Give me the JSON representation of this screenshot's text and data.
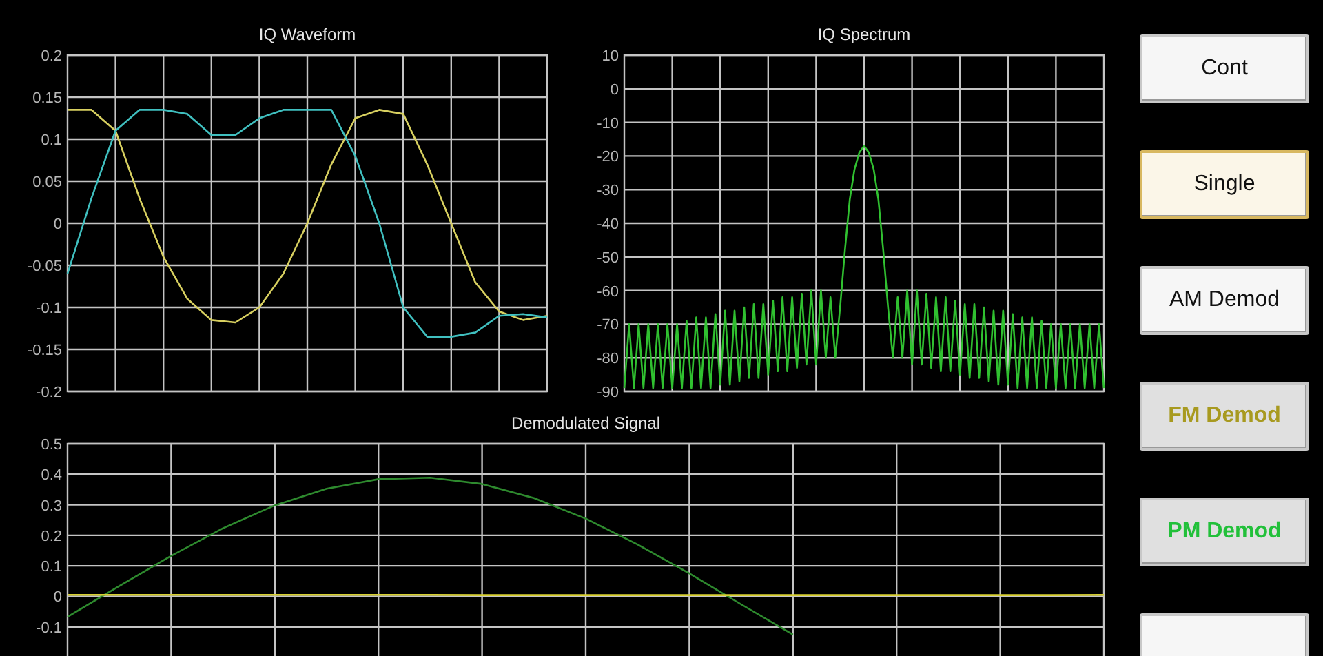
{
  "charts": [
    {
      "chart_data": {
        "type": "line",
        "title": "IQ Waveform",
        "grid": true,
        "ylim": [
          -0.2,
          0.2
        ],
        "yticks": [
          0.2,
          0.15,
          0.1,
          0.05,
          0,
          -0.05,
          -0.1,
          -0.15,
          -0.2
        ],
        "series": [
          {
            "color": "#d8d060",
            "values": [
              0.135,
              0.135,
              0.11,
              0.03,
              -0.04,
              -0.09,
              -0.115,
              -0.118,
              -0.1,
              -0.06,
              0.0,
              0.07,
              0.125,
              0.135,
              0.13,
              0.07,
              0.0,
              -0.07,
              -0.105,
              -0.115,
              -0.11
            ]
          },
          {
            "color": "#40c0c0",
            "values": [
              -0.06,
              0.03,
              0.11,
              0.135,
              0.135,
              0.13,
              0.105,
              0.105,
              0.125,
              0.135,
              0.135,
              0.135,
              0.08,
              0.0,
              -0.1,
              -0.135,
              -0.135,
              -0.13,
              -0.11,
              -0.108,
              -0.112
            ]
          }
        ]
      }
    },
    {
      "chart_data": {
        "type": "line",
        "title": "IQ Spectrum",
        "grid": true,
        "ylim": [
          -90,
          10
        ],
        "yticks": [
          10,
          0,
          -10,
          -20,
          -30,
          -40,
          -50,
          -60,
          -70,
          -80,
          -90
        ],
        "series": [
          {
            "color": "#30c030",
            "values": [
              -89,
              -70,
              -89,
              -70,
              -89,
              -70,
              -89,
              -70,
              -89,
              -70,
              -89,
              -70,
              -89,
              -69,
              -89,
              -68,
              -89,
              -68,
              -89,
              -67,
              -88,
              -66,
              -88,
              -66,
              -87,
              -65,
              -86,
              -64,
              -86,
              -64,
              -85,
              -63,
              -84,
              -62,
              -84,
              -62,
              -83,
              -61,
              -82,
              -60,
              -82,
              -60,
              -80,
              -62,
              -80,
              -65,
              -48,
              -33,
              -24,
              -19,
              -17,
              -19,
              -24,
              -33,
              -48,
              -65,
              -80,
              -62,
              -80,
              -60,
              -82,
              -60,
              -82,
              -61,
              -83,
              -62,
              -84,
              -62,
              -84,
              -63,
              -85,
              -64,
              -86,
              -64,
              -86,
              -65,
              -87,
              -66,
              -88,
              -66,
              -88,
              -67,
              -89,
              -68,
              -89,
              -68,
              -89,
              -69,
              -89,
              -70,
              -89,
              -70,
              -89,
              -70,
              -89,
              -70,
              -89,
              -70,
              -89,
              -70,
              -89
            ]
          }
        ]
      }
    },
    {
      "chart_data": {
        "type": "line",
        "title": "Demodulated Signal",
        "grid": true,
        "ylim": [
          -0.2,
          0.5
        ],
        "yticks": [
          0.5,
          0.4,
          0.3,
          0.2,
          0.1,
          0,
          -0.1
        ],
        "series": [
          {
            "color": "#2e8a2e",
            "values": [
              -0.067,
              0.034,
              0.133,
              0.223,
              0.298,
              0.353,
              0.384,
              0.389,
              0.368,
              0.322,
              0.255,
              0.17,
              0.075,
              -0.026,
              -0.125,
              null,
              null,
              null,
              null,
              null,
              null
            ]
          },
          {
            "color": "#d8d030",
            "values": [
              0.005,
              0.005,
              0.005,
              0.005,
              0.005,
              0.005,
              0.005,
              0.005,
              0.004,
              0.004,
              0.004,
              0.004,
              0.004,
              0.004,
              0.004,
              0.004,
              0.004,
              0.004,
              0.004,
              0.004,
              0.005
            ]
          }
        ]
      }
    }
  ],
  "buttons": [
    {
      "label": "Cont",
      "selected": false,
      "active": false
    },
    {
      "label": "Single",
      "selected": true,
      "active": false
    },
    {
      "label": "AM Demod",
      "selected": false,
      "active": false
    },
    {
      "label": "FM Demod",
      "selected": false,
      "active": true,
      "color": "#a89a20"
    },
    {
      "label": "PM Demod",
      "selected": false,
      "active": true,
      "color": "#22c03a"
    },
    {
      "selected": false,
      "active": false
    }
  ]
}
